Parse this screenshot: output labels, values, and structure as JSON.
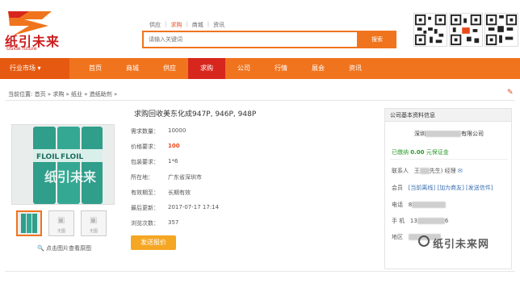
{
  "header": {
    "logo_text": "纸引未来",
    "logo_sub": "Guide future",
    "top_tabs": [
      "供应",
      "求购",
      "商城",
      "资讯"
    ],
    "active_top_tab": "求购",
    "search_placeholder": "请输入关键词",
    "search_button": "搜索",
    "qr_codes": [
      "qr-code-1",
      "qr-code-2",
      "qr-code-3"
    ]
  },
  "navbar": {
    "market_label": "行业市场",
    "items": [
      "首页",
      "商城",
      "供应",
      "求购",
      "公司",
      "行情",
      "展会",
      "资讯"
    ],
    "active": "求购"
  },
  "breadcrumb": "当前位置: 首页 » 求购 » 纸业 » 造纸助剂 »",
  "product": {
    "title": "求购回收美东化成947P, 946P, 948P",
    "thumbs": [
      "",
      "无图",
      "无图"
    ],
    "view_original": "点击图片查看原图",
    "rows": [
      {
        "label": "需求数量：",
        "value": "10000"
      },
      {
        "label": "价格要求：",
        "value": "100"
      },
      {
        "label": "包装要求：",
        "value": "1*6"
      },
      {
        "label": "所在地：",
        "value": "广东省深圳市"
      },
      {
        "label": "有效期至：",
        "value": "长期有效"
      },
      {
        "label": "最后更新：",
        "value": "2017-07-17 17:14"
      },
      {
        "label": "浏览次数：",
        "value": "357"
      }
    ],
    "send_button": "发送报价"
  },
  "company": {
    "panel_title": "公司基本资料信息",
    "name_prefix": "深圳",
    "name_suffix": "有限公司",
    "paid_label": "已缴纳",
    "paid_amount": "0.00",
    "paid_suffix": "元保证金",
    "contact_label": "联系人",
    "contact_name": "王",
    "contact_title": "先生) 经理",
    "member_label": "会员",
    "member_links": "[当前离线] [加为商友] [发送信件]",
    "phone_label": "电话",
    "phone_value": "8",
    "mobile_label": "手 机",
    "mobile_prefix": "13",
    "mobile_suffix": "6",
    "area_label": "地区"
  },
  "watermark": "纸引未来网",
  "colors": {
    "brand_orange": "#f0741e",
    "active_red": "#d7261e",
    "price_red": "#e8481c",
    "paid_green": "#2a9a2a"
  }
}
